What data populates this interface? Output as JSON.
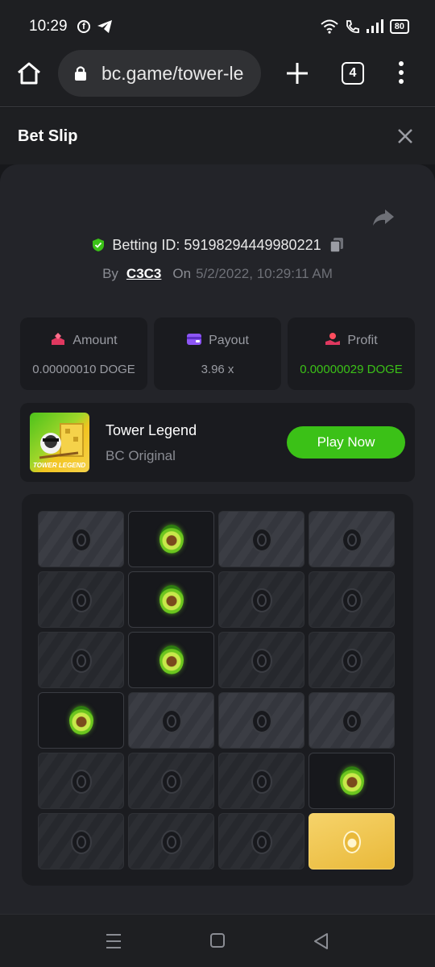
{
  "status": {
    "time": "10:29",
    "battery": "80"
  },
  "browser": {
    "url": "bc.game/tower-le",
    "tab_count": "4"
  },
  "slip": {
    "title": "Bet Slip"
  },
  "bet": {
    "betting_id_text": "Betting ID: 59198294449980221",
    "by_label": "By",
    "user": "C3C3",
    "on_label": "On",
    "date": "5/2/2022, 10:29:11 AM"
  },
  "stats": {
    "amount_label": "Amount",
    "amount_value": "0.00000010 DOGE",
    "payout_label": "Payout",
    "payout_value": "3.96 x",
    "profit_label": "Profit",
    "profit_value": "0.00000029 DOGE"
  },
  "game": {
    "name": "Tower Legend",
    "provider": "BC Original",
    "play_label": "Play Now",
    "thumb_text": "TOWER LEGEND"
  },
  "board": {
    "rows": [
      [
        "light",
        "avocado",
        "light",
        "light"
      ],
      [
        "dark",
        "avocado",
        "dark",
        "dark"
      ],
      [
        "dark",
        "avocado",
        "dark",
        "dark"
      ],
      [
        "avocado",
        "light",
        "light",
        "light"
      ],
      [
        "dark",
        "dark",
        "dark",
        "avocado"
      ],
      [
        "dark",
        "dark",
        "dark",
        "gold"
      ]
    ]
  },
  "colors": {
    "accent_green": "#3bc117",
    "gold": "#e9b93a",
    "background": "#17181b"
  },
  "icons": [
    "facebook-icon",
    "telegram-icon",
    "wifi-icon",
    "call-icon",
    "signal-icon",
    "battery-icon",
    "home-icon",
    "lock-icon",
    "plus-icon",
    "tabs-icon",
    "more-vert-icon",
    "close-icon",
    "share-icon",
    "shield-check-icon",
    "copy-icon",
    "amount-icon",
    "payout-icon",
    "profit-icon"
  ]
}
